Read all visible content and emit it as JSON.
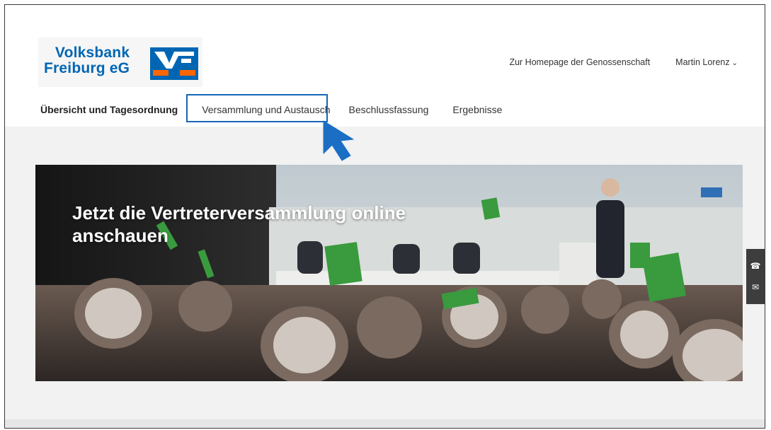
{
  "brand": {
    "name_line1": "Volksbank",
    "name_line2": "Freiburg eG",
    "brand_blue": "#0066b3",
    "brand_orange": "#ff6600"
  },
  "header": {
    "homepage_link": "Zur Homepage der Genossenschaft",
    "user_name": "Martin Lorenz",
    "user_menu_icon": "chevron-down-icon"
  },
  "nav": {
    "items": [
      {
        "label": "Übersicht und Tagesordnung",
        "active": true
      },
      {
        "label": "Versammlung und Austausch",
        "active": false,
        "highlighted": true
      },
      {
        "label": "Beschlussfassung",
        "active": false
      },
      {
        "label": "Ergebnisse",
        "active": false
      }
    ]
  },
  "hero": {
    "title": "Jetzt die Vertreterversammlung online anschauen"
  },
  "side_contact": {
    "icons": [
      "phone-icon",
      "mail-icon"
    ],
    "phone_glyph": "☎",
    "mail_glyph": "✉"
  },
  "colors": {
    "highlight_box": "#1666b5",
    "cursor": "#1a6fc4",
    "active_underline": "#ff6600"
  }
}
